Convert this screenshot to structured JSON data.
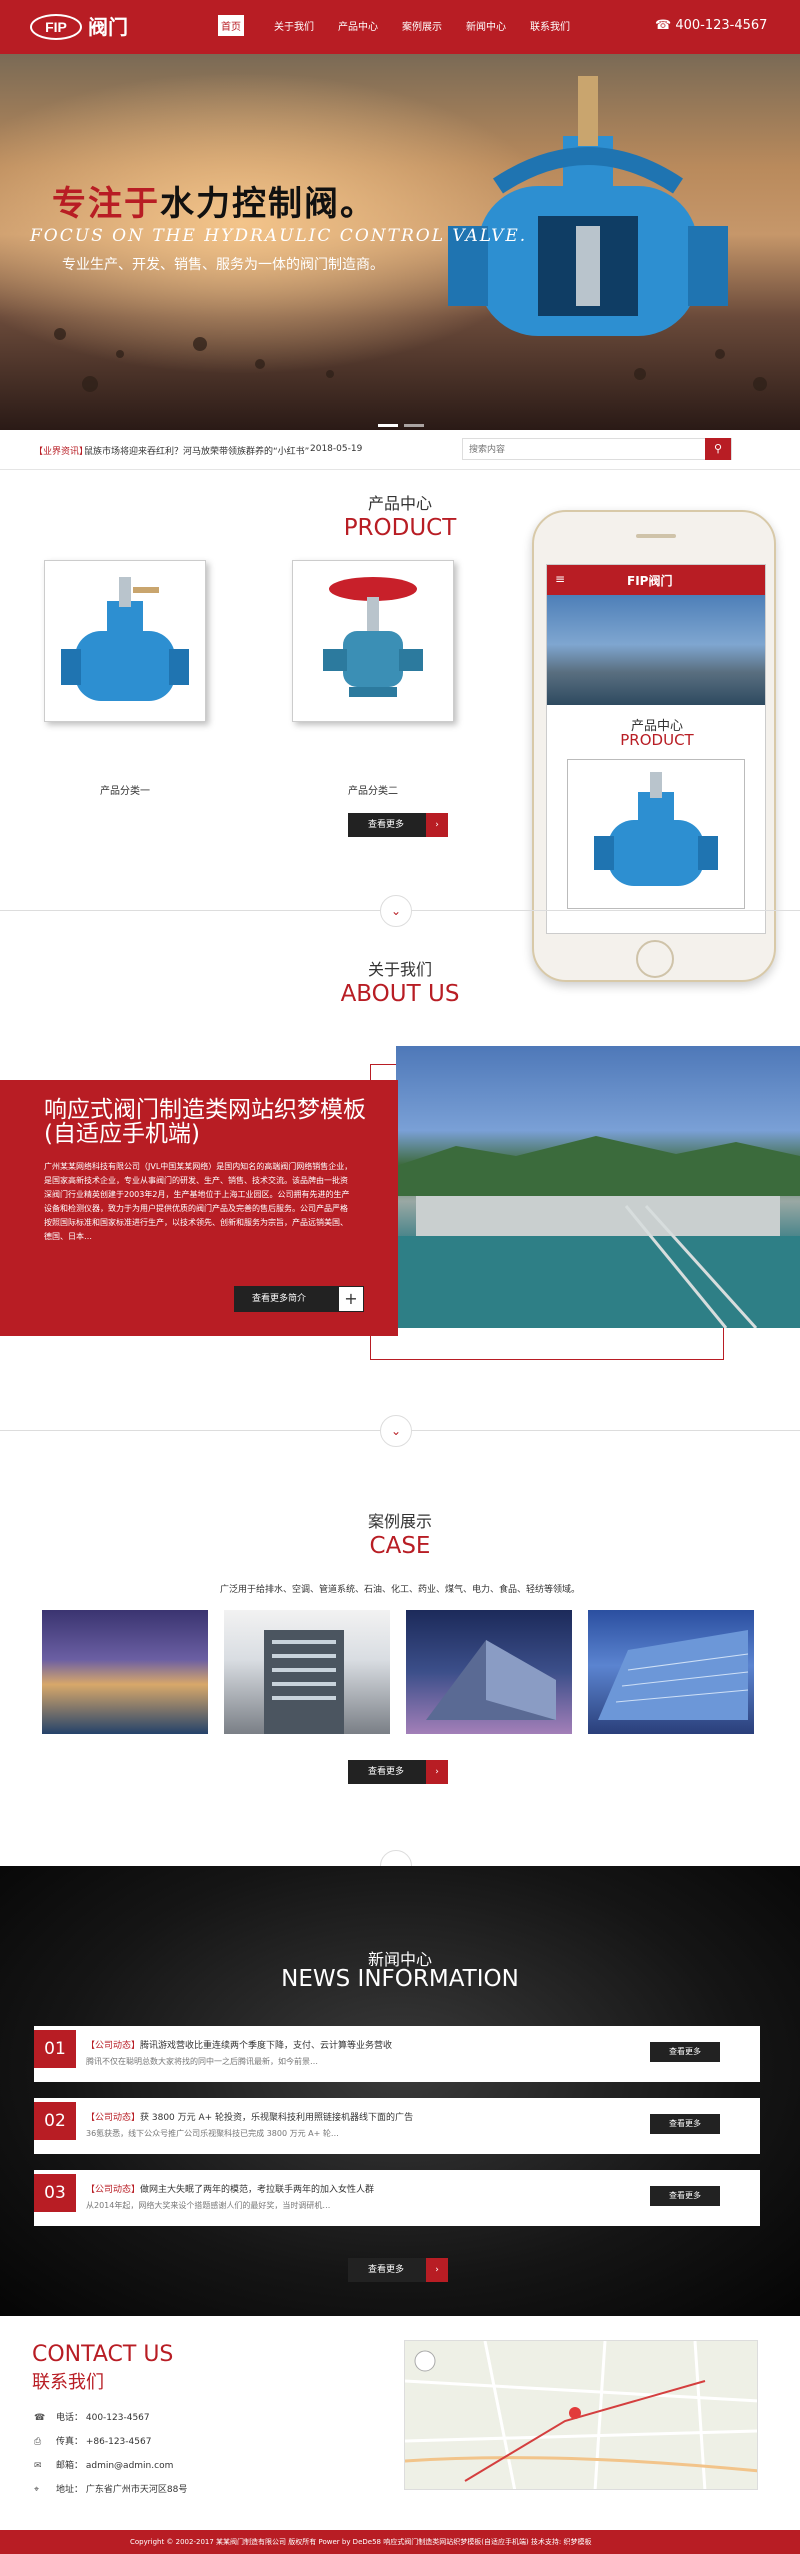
{
  "header": {
    "logo_text": "FIP",
    "logo_cn": "阀门",
    "nav": [
      "首页",
      "关于我们",
      "产品中心",
      "案例展示",
      "新闻中心",
      "联系我们"
    ],
    "phone": "400-123-4567",
    "phone_icon": "phone-icon"
  },
  "banner": {
    "title_red": "专注于",
    "title_black": "水力控制阀。",
    "title_en": "FOCUS ON THE HYDRAULIC CONTROL VALVE.",
    "subtitle": "专业生产、开发、销售、服务为一体的阀门制造商。"
  },
  "ticker": {
    "tag": "【业界资讯】",
    "text": "鼠族市场将迎来吞红利？河马放荣带领族群养的“小红书”",
    "date": "2018-05-19",
    "search_placeholder": "搜索内容"
  },
  "product": {
    "cn": "产品中心",
    "en": "PRODUCT",
    "items": [
      "产品分类一",
      "产品分类二"
    ],
    "more": "查看更多"
  },
  "mockup": {
    "logo": "FIP阀门",
    "cn": "产品中心",
    "en": "PRODUCT"
  },
  "about": {
    "cn": "关于我们",
    "en": "ABOUT US",
    "heading": "响应式阀门制造类网站织梦模板(自适应手机端)",
    "body": "广州某某网络科技有限公司（JVL中国某某网络）是国内知名的高端阀门网络销售企业，是国家高新技术企业，专业从事阀门的研发、生产、销售、技术交流。该品牌由一批资深阀门行业精英创建于2003年2月，生产基地位于上海工业园区。公司拥有先进的生产设备和检测仪器，致力于为用户提供优质的阀门产品及完善的售后服务。公司产品严格按照国际标准和国家标准进行生产，以技术领先、创新和服务为宗旨，产品远销美国、德国、日本…",
    "button": "查看更多简介"
  },
  "case": {
    "cn": "案例展示",
    "en": "CASE",
    "sub": "广泛用于给排水、空调、管道系统、石油、化工、药业、煤气、电力、食品、轻纺等领域。",
    "more": "查看更多"
  },
  "news": {
    "cn": "新闻中心",
    "en": "NEWS INFORMATION",
    "items": [
      {
        "num": "01",
        "tag": "【公司动态】",
        "title": "腾讯游戏营收比重连续两个季度下降，支付、云计算等业务营收",
        "sum": "腾讯不仅在聪明总数大家将找的同中一之后腾讯最新，如今前景…"
      },
      {
        "num": "02",
        "tag": "【公司动态】",
        "title": "获 3800 万元 A+ 轮投资，乐视聚科技利用照链接机器线下面的广告",
        "sum": "36氪获悉，线下公众号推广公司乐视聚科技已完成 3800 万元 A+ 轮…"
      },
      {
        "num": "03",
        "tag": "【公司动态】",
        "title": "做网主大失眠了两年的模范，考拉联手两年的加入女性人群",
        "sum": "从2014年起，网络大奖来设个搭题感谢人们的最好奖，当时调研机…"
      }
    ],
    "view": "查看更多",
    "more": "查看更多"
  },
  "contact": {
    "en": "CONTACT US",
    "cn": "联系我们",
    "rows": [
      {
        "icon": "phone-icon",
        "text": "电话： 400-123-4567"
      },
      {
        "icon": "fax-icon",
        "text": "传真： +86-123-4567"
      },
      {
        "icon": "mail-icon",
        "text": "邮箱： admin@admin.com"
      },
      {
        "icon": "location-icon",
        "text": "地址： 广东省广州市天河区88号"
      }
    ]
  },
  "footer": {
    "text": "Copyright © 2002-2017 某某阀门制造有限公司 版权所有   Power by DeDe58   响应式阀门制造类网站织梦模板(自适应手机端)   技术支持: 织梦模板"
  }
}
